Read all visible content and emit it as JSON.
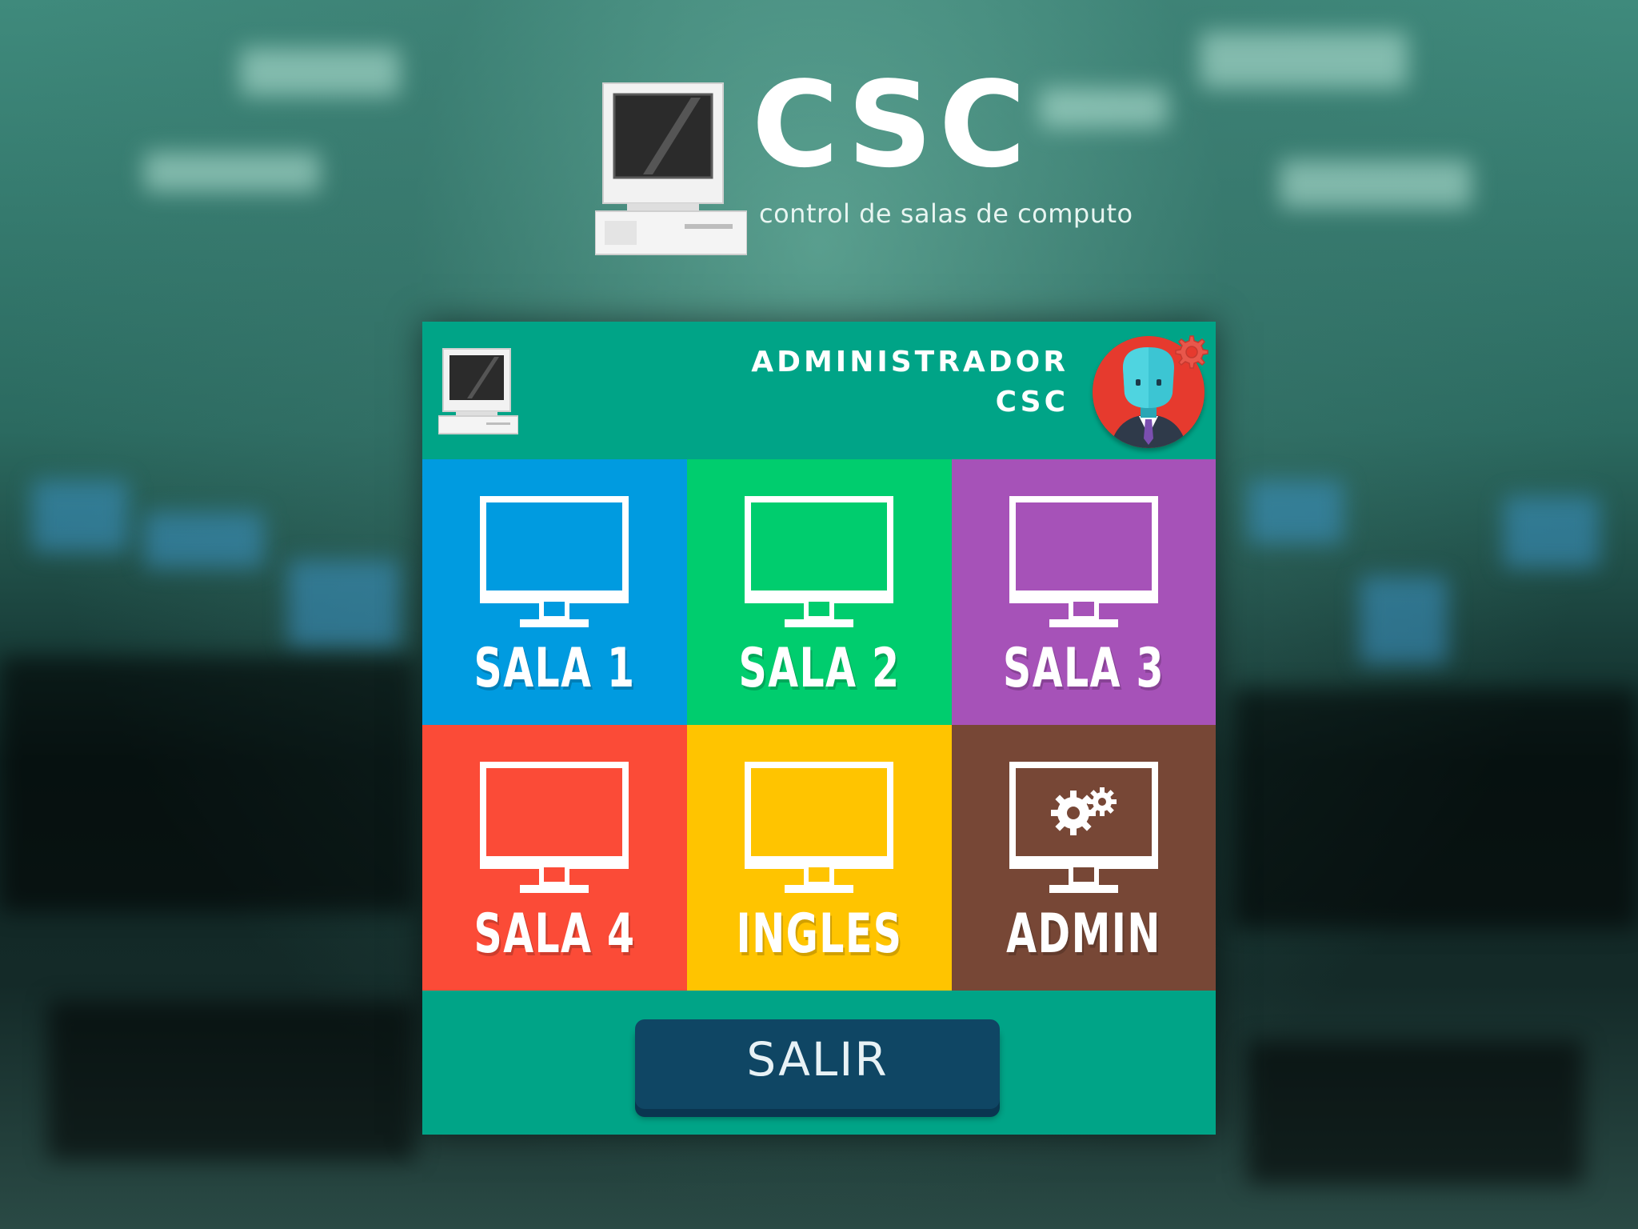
{
  "logo": {
    "title": "CSC",
    "subtitle": "control de salas de computo"
  },
  "header": {
    "user_role": "ADMINISTRADOR",
    "user_name": "CSC"
  },
  "tiles": [
    {
      "label": "SALA 1",
      "color": "#009be0",
      "icon": "monitor-icon"
    },
    {
      "label": "SALA 2",
      "color": "#00cd6e",
      "icon": "monitor-icon"
    },
    {
      "label": "SALA 3",
      "color": "#a652b8",
      "icon": "monitor-icon"
    },
    {
      "label": "SALA 4",
      "color": "#fb4b37",
      "icon": "monitor-icon"
    },
    {
      "label": "INGLES",
      "color": "#ffc400",
      "icon": "monitor-icon"
    },
    {
      "label": "ADMIN",
      "color": "#774736",
      "icon": "monitor-gears-icon"
    }
  ],
  "exit_button": {
    "label": "SALIR",
    "color": "#0f4664"
  },
  "colors": {
    "panel": "#00a487",
    "avatar_bg": "#e63a2e"
  }
}
